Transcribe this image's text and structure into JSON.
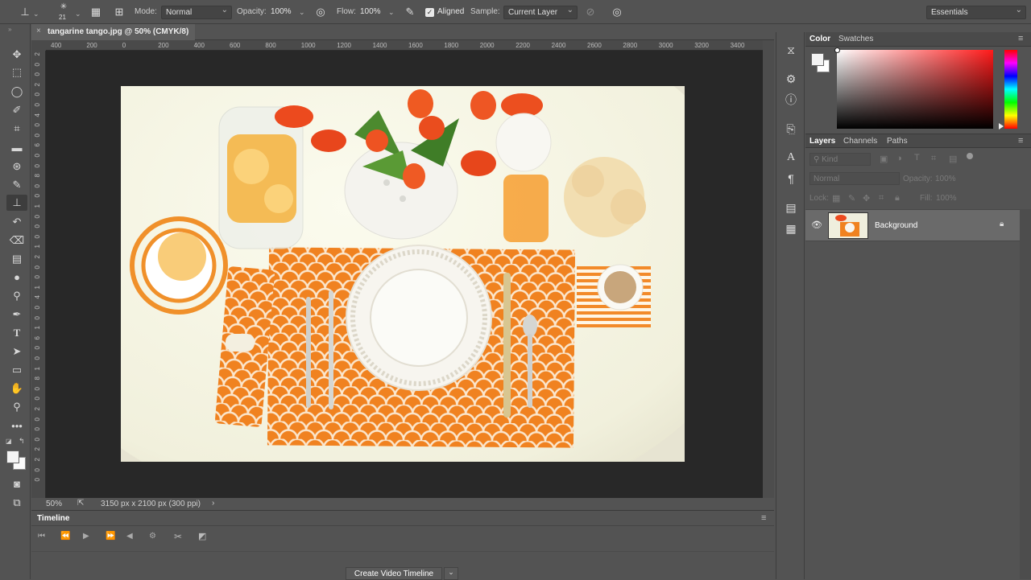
{
  "options_bar": {
    "brush_size": "21",
    "mode_label": "Mode:",
    "mode_value": "Normal",
    "opacity_label": "Opacity:",
    "opacity_value": "100%",
    "flow_label": "Flow:",
    "flow_value": "100%",
    "aligned_label": "Aligned",
    "aligned_checked": true,
    "sample_label": "Sample:",
    "sample_value": "Current Layer",
    "workspace_value": "Essentials"
  },
  "document": {
    "tab_title": "tangarine tango.jpg @ 50% (CMYK/8)",
    "zoom": "50%",
    "doc_info": "3150 px x 2100 px (300 ppi)",
    "ruler_top": [
      "400",
      "200",
      "0",
      "200",
      "400",
      "600",
      "800",
      "1000",
      "1200",
      "1400",
      "1600",
      "1800",
      "2000",
      "2200",
      "2400",
      "2600",
      "2800",
      "3000",
      "3200",
      "3400"
    ],
    "ruler_left": [
      "2",
      "0",
      "0",
      "2",
      "0",
      "0",
      "4",
      "0",
      "0",
      "6",
      "0",
      "0",
      "8",
      "0",
      "0",
      "1",
      "0",
      "0",
      "0",
      "1",
      "2",
      "0",
      "0",
      "1",
      "4",
      "0",
      "0",
      "1",
      "6",
      "0",
      "0",
      "1",
      "8",
      "0",
      "0",
      "2",
      "0",
      "0",
      "0",
      "2",
      "2",
      "0",
      "0"
    ]
  },
  "timeline": {
    "title": "Timeline",
    "create_button": "Create Video Timeline"
  },
  "color_panel": {
    "tabs": [
      "Color",
      "Swatches"
    ],
    "active_tab": "Color"
  },
  "layers_panel": {
    "tabs": [
      "Layers",
      "Channels",
      "Paths"
    ],
    "active_tab": "Layers",
    "filter_placeholder": "Kind",
    "blend_mode": "Normal",
    "opacity_label": "Opacity:",
    "opacity_value": "100%",
    "lock_label": "Lock:",
    "fill_label": "Fill:",
    "fill_value": "100%",
    "layers": [
      {
        "name": "Background",
        "visible": true,
        "locked": true
      }
    ]
  },
  "colors": {
    "ui_bg": "#535353",
    "canvas_bg": "#282828",
    "placemat_orange": "#f0801e",
    "picker_hue": "#ff1a1a"
  }
}
